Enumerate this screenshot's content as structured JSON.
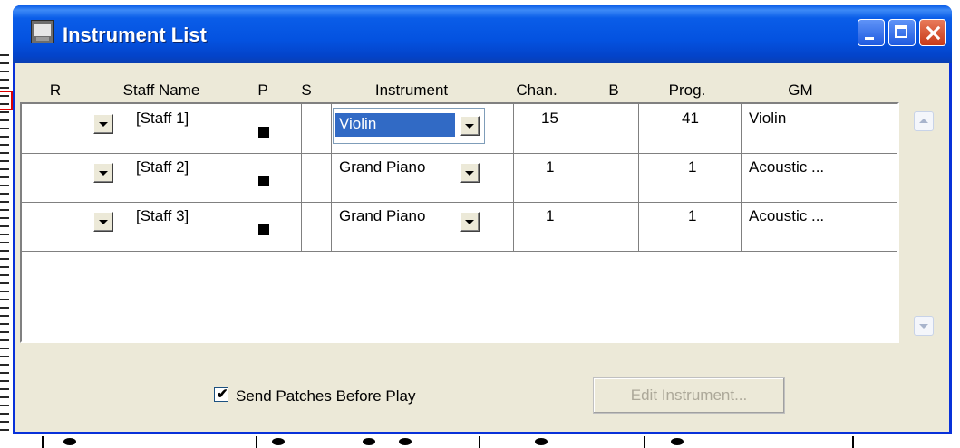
{
  "window": {
    "title": "Instrument List"
  },
  "columns": [
    "R",
    "Staff Name",
    "P",
    "S",
    "Instrument",
    "Chan.",
    "B",
    "Prog.",
    "GM"
  ],
  "rows": [
    {
      "staff_name": "[Staff 1]",
      "instrument": "Violin",
      "chan": "15",
      "prog": "41",
      "gm": "Violin"
    },
    {
      "staff_name": "[Staff 2]",
      "instrument": "Grand Piano",
      "chan": "1",
      "prog": "1",
      "gm": "Acoustic ..."
    },
    {
      "staff_name": "[Staff 3]",
      "instrument": "Grand Piano",
      "chan": "1",
      "prog": "1",
      "gm": "Acoustic ..."
    }
  ],
  "footer": {
    "send_patches_label": "Send Patches Before Play",
    "send_patches_checked": true,
    "edit_instrument_label": "Edit Instrument..."
  },
  "colors": {
    "title_bar": "#0a5de8",
    "selection": "#316ac5",
    "dialog_bg": "#ece9d8"
  }
}
